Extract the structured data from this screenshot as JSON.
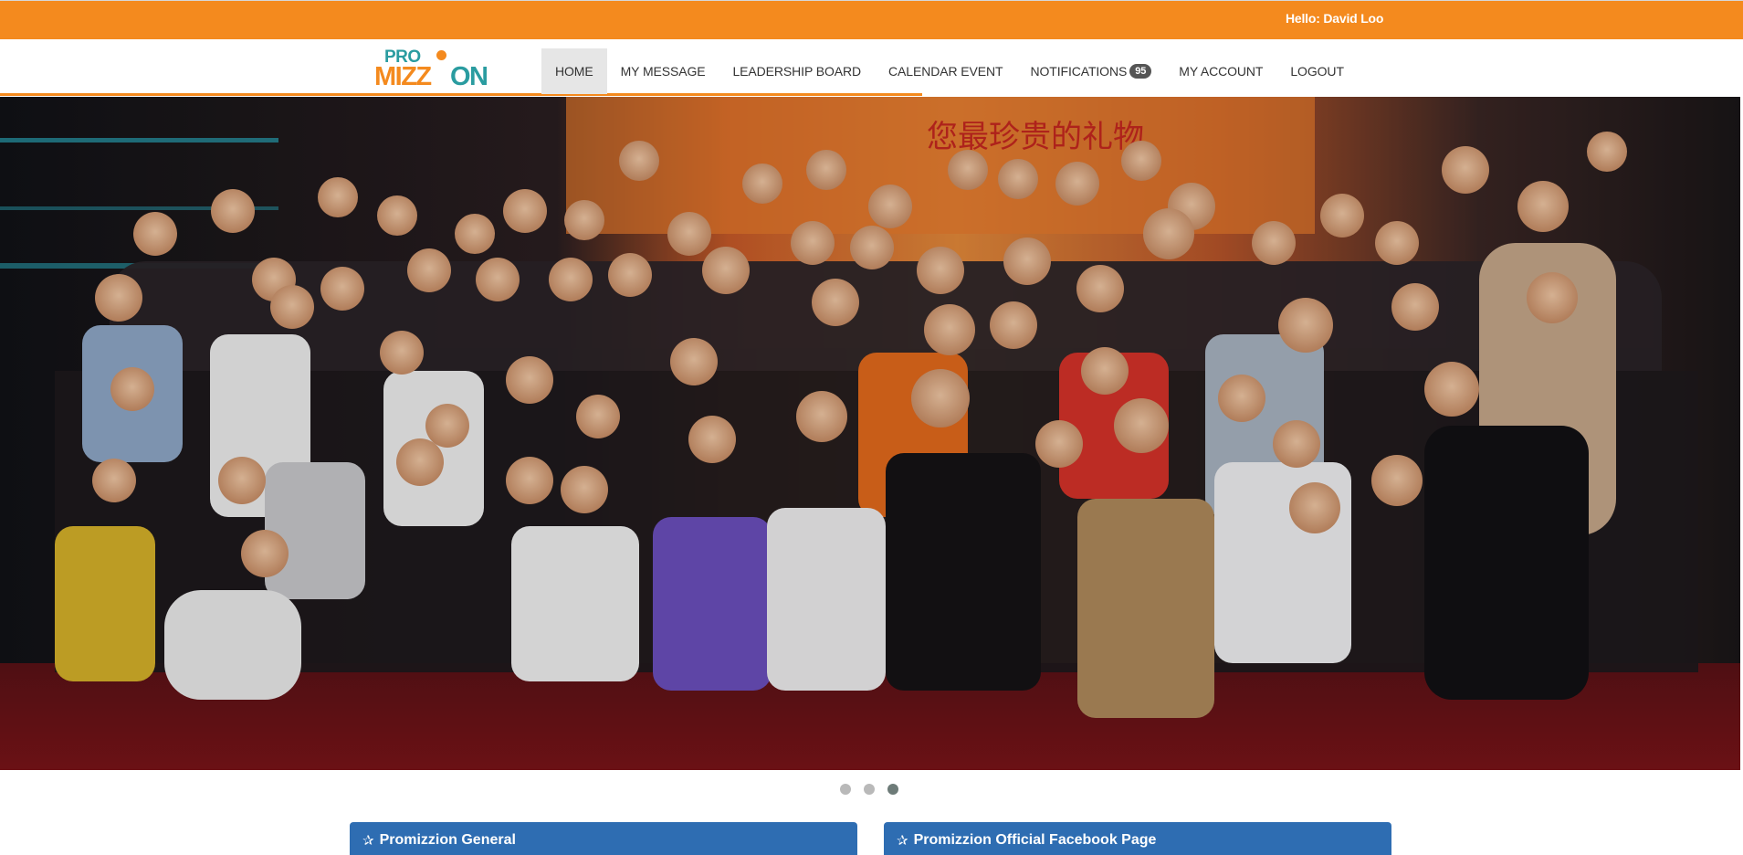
{
  "header": {
    "greeting": "Hello: David Loo"
  },
  "logo": {
    "line1": "PRO",
    "line2_left": "MIZZ",
    "line2_right": "ON"
  },
  "nav": {
    "items": [
      {
        "label": "HOME",
        "active": true
      },
      {
        "label": "MY MESSAGE"
      },
      {
        "label": "LEADERSHIP BOARD"
      },
      {
        "label": "CALENDAR EVENT"
      },
      {
        "label": "NOTIFICATIONS",
        "badge": "95"
      },
      {
        "label": "MY ACCOUNT"
      },
      {
        "label": "LOGOUT"
      }
    ]
  },
  "hero": {
    "banner_text": "您最珍贵的礼物"
  },
  "carousel": {
    "count": 3,
    "active_index": 2
  },
  "panels": {
    "left_title": "Promizzion General",
    "right_title": "Promizzion Official Facebook Page"
  },
  "colors": {
    "brand_orange": "#f48a1e",
    "brand_teal": "#2a9ca0",
    "panel_blue": "#2e6db2"
  }
}
